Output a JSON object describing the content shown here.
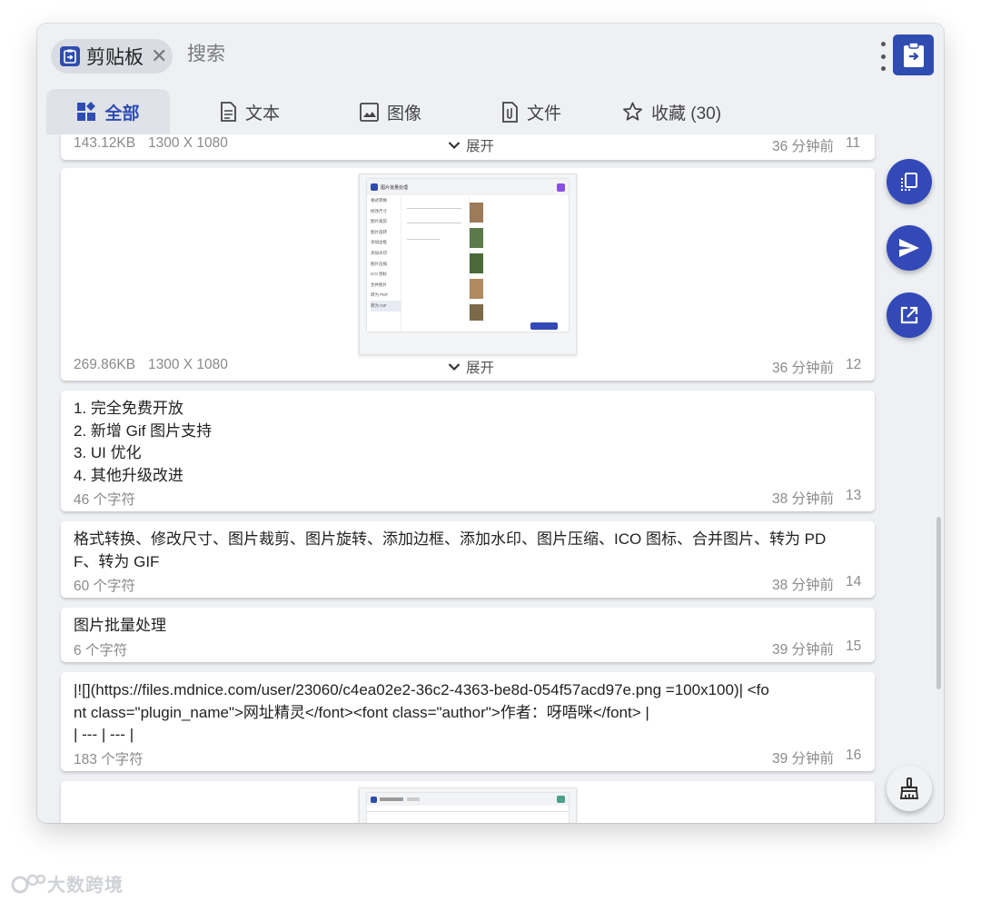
{
  "header": {
    "chip_label": "剪贴板",
    "search_placeholder": "搜索"
  },
  "tabs": [
    {
      "label": "全部",
      "icon": "dashboard-icon",
      "active": true
    },
    {
      "label": "文本",
      "icon": "document-icon"
    },
    {
      "label": "图像",
      "icon": "image-icon"
    },
    {
      "label": "文件",
      "icon": "paperclip-file-icon"
    },
    {
      "label": "收藏 (30)",
      "icon": "star-icon"
    }
  ],
  "items": [
    {
      "size": "143.12KB",
      "dimensions": "1300 X 1080",
      "expand": "展开",
      "time": "36 分钟前",
      "index": "11"
    },
    {
      "size": "269.86KB",
      "dimensions": "1300 X 1080",
      "expand": "展开",
      "time": "36 分钟前",
      "index": "12"
    },
    {
      "lines": [
        "1. 完全免费开放",
        "2. 新增 Gif 图片支持",
        "3. UI 优化",
        "4. 其他升级改进"
      ],
      "count": "46 个字符",
      "time": "38 分钟前",
      "index": "13"
    },
    {
      "lines": [
        "格式转换、修改尺寸、图片裁剪、图片旋转、添加边框、添加水印、图片压缩、ICO 图标、合并图片、转为 PD",
        "F、转为 GIF"
      ],
      "count": "60 个字符",
      "time": "38 分钟前",
      "index": "14"
    },
    {
      "lines": [
        "图片批量处理"
      ],
      "count": "6 个字符",
      "time": "39 分钟前",
      "index": "15"
    },
    {
      "lines": [
        "|![](https://files.mdnice.com/user/23060/c4ea02e2-36c2-4363-be8d-054f57acd97e.png =100x100)| <fo",
        "nt class=\"plugin_name\">网址精灵</font><font class=\"author\">作者：呀唔咪</font> |",
        "| --- | --- |"
      ],
      "count": "183 个字符",
      "time": "39 分钟前",
      "index": "16"
    }
  ],
  "thumb": {
    "app_tab": "图片批量处理",
    "menu": [
      "格式转换",
      "修改尺寸",
      "图片裁剪",
      "图片旋转",
      "添加边框",
      "添加水印",
      "图片压缩",
      "ICO 图标",
      "合并图片",
      "转为 PDF",
      "转为 GIF"
    ]
  },
  "fabs": [
    "copy-icon",
    "send-icon",
    "open-external-icon",
    "broom-clear-icon"
  ],
  "watermark": "大数跨境",
  "colors": {
    "accent": "#2f4db0",
    "fab": "#3349b8",
    "background": "#eef0f3"
  }
}
